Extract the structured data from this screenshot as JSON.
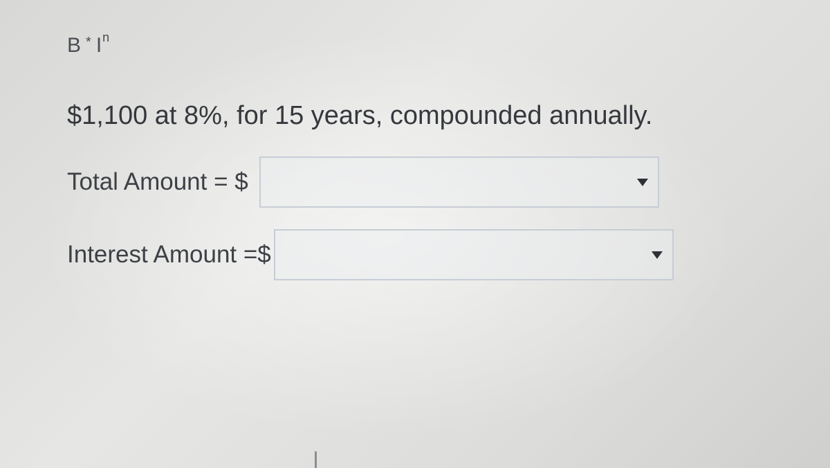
{
  "formula": {
    "base": "B",
    "operator": "*",
    "factor": "I",
    "exponent": "n"
  },
  "problem": {
    "text": "$1,100 at 8%, for 15 years, compounded annually."
  },
  "fields": {
    "total": {
      "label": "Total Amount = $",
      "value": ""
    },
    "interest": {
      "label": "Interest Amount =$",
      "value": ""
    }
  },
  "icons": {
    "dropdown_caret": "chevron-down-icon"
  }
}
